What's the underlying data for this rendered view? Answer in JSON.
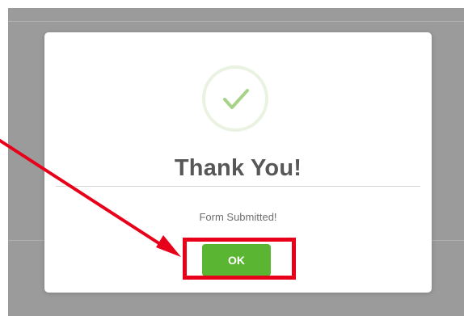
{
  "modal": {
    "title": "Thank You!",
    "message": "Form Submitted!",
    "ok_label": "OK",
    "success_icon": "check-circle-icon"
  },
  "annotation": {
    "color": "#e8001a",
    "arrow_icon": "red-arrow",
    "highlight_target": "ok-button"
  },
  "colors": {
    "backdrop": "#9b9b9b",
    "button": "#5ab632",
    "check": "#a6d387",
    "title": "#575757"
  }
}
